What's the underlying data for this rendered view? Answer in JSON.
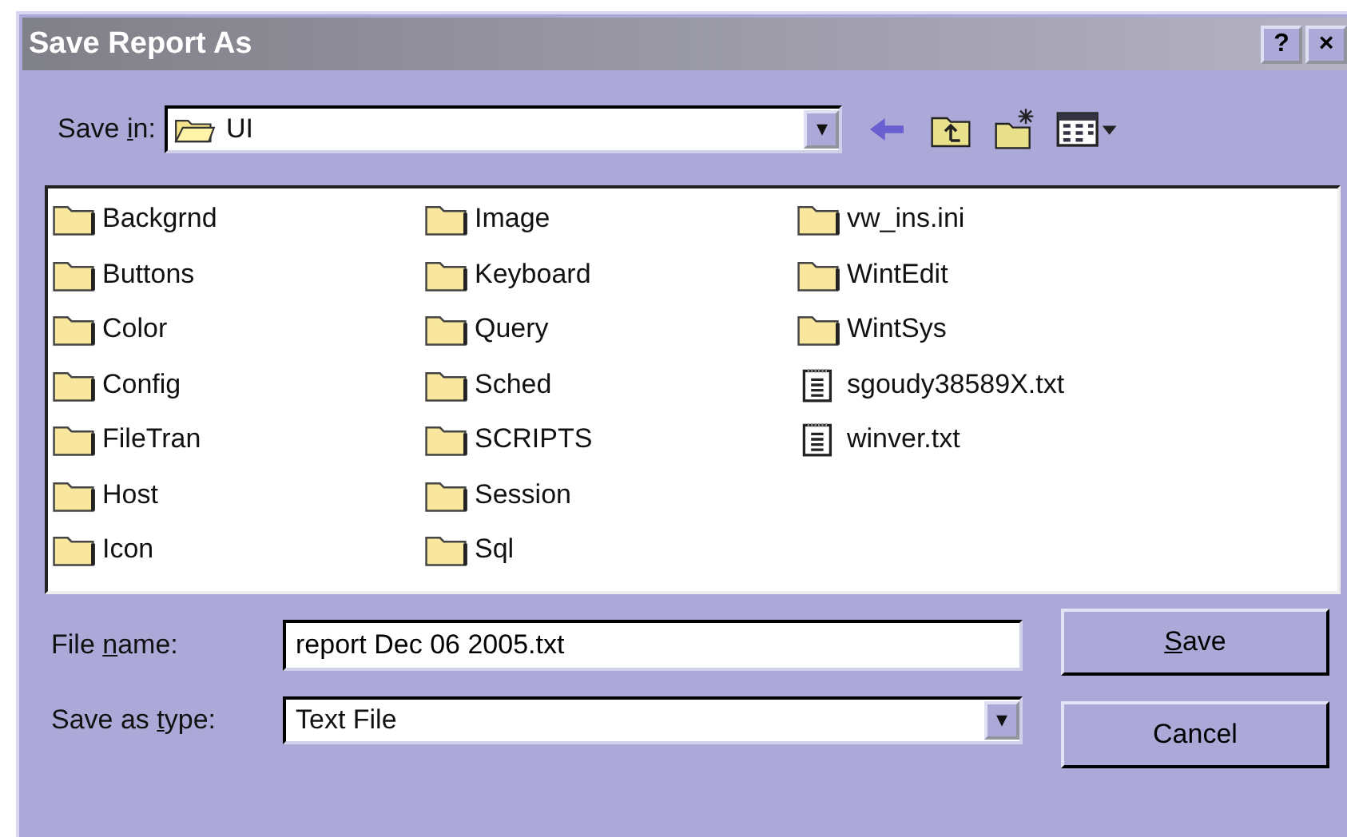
{
  "window": {
    "title": "Save Report As",
    "help_button": "?",
    "close_button": "×"
  },
  "save_in": {
    "label": {
      "pre": "Save ",
      "key": "i",
      "post": "n:"
    },
    "value": "UI",
    "dropdown": "▾"
  },
  "files": [
    {
      "name": "Backgrnd",
      "kind": "folder"
    },
    {
      "name": "Buttons",
      "kind": "folder"
    },
    {
      "name": "Color",
      "kind": "folder"
    },
    {
      "name": "Config",
      "kind": "folder"
    },
    {
      "name": "FileTran",
      "kind": "folder"
    },
    {
      "name": "Host",
      "kind": "folder"
    },
    {
      "name": "Icon",
      "kind": "folder"
    },
    {
      "name": "Image",
      "kind": "folder"
    },
    {
      "name": "Keyboard",
      "kind": "folder"
    },
    {
      "name": "Query",
      "kind": "folder"
    },
    {
      "name": "Sched",
      "kind": "folder"
    },
    {
      "name": "SCRIPTS",
      "kind": "folder"
    },
    {
      "name": "Session",
      "kind": "folder"
    },
    {
      "name": "Sql",
      "kind": "folder"
    },
    {
      "name": "vw_ins.ini",
      "kind": "folder"
    },
    {
      "name": "WintEdit",
      "kind": "folder"
    },
    {
      "name": "WintSys",
      "kind": "folder"
    },
    {
      "name": "sgoudy38589X.txt",
      "kind": "text"
    },
    {
      "name": "winver.txt",
      "kind": "text"
    }
  ],
  "file_name": {
    "label": {
      "pre": "File ",
      "key": "n",
      "post": "ame:"
    },
    "value": "report Dec 06 2005.txt"
  },
  "save_as_type": {
    "label": {
      "pre": "Save as ",
      "key": "t",
      "post": "ype:"
    },
    "value": "Text File",
    "dropdown": "▾"
  },
  "buttons": [
    {
      "label": {
        "key": "S",
        "post": "ave"
      }
    },
    {
      "label": {
        "pre": "Cancel"
      }
    }
  ]
}
